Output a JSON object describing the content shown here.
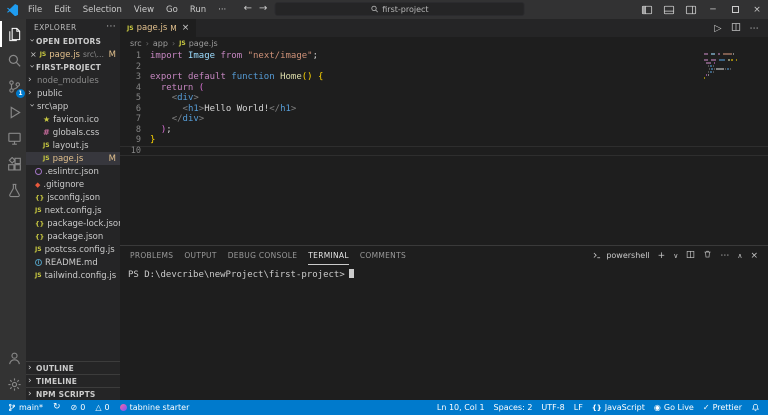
{
  "colors": {
    "accent": "#007acc",
    "git_modified": "#e2c08d",
    "statusbar": "#007acc"
  },
  "titlebar": {
    "menus": [
      "File",
      "Edit",
      "Selection",
      "View",
      "Go",
      "Run",
      "···"
    ],
    "search_value": "first-project",
    "window_icons": [
      "layout-sidebar-icon",
      "layout-panel-icon",
      "layout-sidebar-right-icon",
      "minimize-icon",
      "maximize-icon",
      "close-icon"
    ]
  },
  "activity_bar": {
    "items": [
      {
        "name": "explorer",
        "active": true
      },
      {
        "name": "search"
      },
      {
        "name": "source-control",
        "badge": "1"
      },
      {
        "name": "run-and-debug"
      },
      {
        "name": "remote-explorer"
      },
      {
        "name": "extensions"
      },
      {
        "name": "testing"
      }
    ],
    "bottom_items": [
      {
        "name": "accounts"
      },
      {
        "name": "settings"
      }
    ]
  },
  "sidebar": {
    "title": "EXPLORER",
    "open_editors": {
      "label": "OPEN EDITORS",
      "items": [
        {
          "file": "page.js",
          "path": "src\\app",
          "badge": "M",
          "icon": "js"
        }
      ]
    },
    "project_label": "FIRST-PROJECT",
    "tree": [
      {
        "label": "node_modules",
        "chevron": "right",
        "depth": 1,
        "dim": true
      },
      {
        "label": "public",
        "chevron": "right",
        "depth": 1
      },
      {
        "label": "src\\app",
        "chevron": "down",
        "depth": 1
      },
      {
        "label": "favicon.ico",
        "icon": "star",
        "depth": 2
      },
      {
        "label": "globals.css",
        "icon": "css",
        "depth": 2
      },
      {
        "label": "layout.js",
        "icon": "js",
        "depth": 2
      },
      {
        "label": "page.js",
        "icon": "js",
        "depth": 2,
        "selected": true,
        "modified": true,
        "badge": "M"
      },
      {
        "label": ".eslintrc.json",
        "icon": "eslint",
        "depth": 1
      },
      {
        "label": ".gitignore",
        "icon": "git",
        "depth": 1
      },
      {
        "label": "jsconfig.json",
        "icon": "json",
        "depth": 1
      },
      {
        "label": "next.config.js",
        "icon": "js",
        "depth": 1
      },
      {
        "label": "package-lock.json",
        "icon": "json",
        "depth": 1
      },
      {
        "label": "package.json",
        "icon": "json",
        "depth": 1
      },
      {
        "label": "postcss.config.js",
        "icon": "js",
        "depth": 1
      },
      {
        "label": "README.md",
        "icon": "info",
        "depth": 1
      },
      {
        "label": "tailwind.config.js",
        "icon": "js",
        "depth": 1
      }
    ],
    "bottom_sections": [
      "OUTLINE",
      "TIMELINE",
      "NPM SCRIPTS"
    ]
  },
  "editor": {
    "tab": {
      "label": "page.js",
      "badge": "M"
    },
    "breadcrumb": [
      {
        "label": "src"
      },
      {
        "label": "app"
      },
      {
        "label": "page.js",
        "icon": "js"
      }
    ],
    "code": [
      {
        "n": 1,
        "tokens": [
          [
            "import",
            "kw"
          ],
          [
            " ",
            "fg"
          ],
          [
            "Image",
            "var"
          ],
          [
            " ",
            "fg"
          ],
          [
            "from",
            "kw"
          ],
          [
            " ",
            "fg"
          ],
          [
            "\"next/image\"",
            "str"
          ],
          [
            ";",
            "fg"
          ]
        ]
      },
      {
        "n": 2,
        "tokens": []
      },
      {
        "n": 3,
        "tokens": [
          [
            "export",
            "kw"
          ],
          [
            " ",
            "fg"
          ],
          [
            "default",
            "kw"
          ],
          [
            " ",
            "fg"
          ],
          [
            "function",
            "kw2"
          ],
          [
            " ",
            "fg"
          ],
          [
            "Home",
            "fn"
          ],
          [
            "()",
            "b1"
          ],
          [
            " ",
            "fg"
          ],
          [
            "{",
            "b1"
          ]
        ]
      },
      {
        "n": 4,
        "tokens": [
          [
            "  ",
            "fg"
          ],
          [
            "return",
            "kw"
          ],
          [
            " ",
            "fg"
          ],
          [
            "(",
            "b2"
          ]
        ]
      },
      {
        "n": 5,
        "tokens": [
          [
            "    ",
            "fg"
          ],
          [
            "<",
            "tagb"
          ],
          [
            "div",
            "tag"
          ],
          [
            ">",
            "tagb"
          ]
        ]
      },
      {
        "n": 6,
        "tokens": [
          [
            "      ",
            "fg"
          ],
          [
            "<",
            "tagb"
          ],
          [
            "h1",
            "tag"
          ],
          [
            ">",
            "tagb"
          ],
          [
            "Hello World!",
            "fg"
          ],
          [
            "</",
            "tagb"
          ],
          [
            "h1",
            "tag"
          ],
          [
            ">",
            "tagb"
          ]
        ]
      },
      {
        "n": 7,
        "tokens": [
          [
            "    ",
            "fg"
          ],
          [
            "</",
            "tagb"
          ],
          [
            "div",
            "tag"
          ],
          [
            ">",
            "tagb"
          ]
        ]
      },
      {
        "n": 8,
        "tokens": [
          [
            "  ",
            "fg"
          ],
          [
            ")",
            "b2"
          ],
          [
            ";",
            "fg"
          ]
        ]
      },
      {
        "n": 9,
        "tokens": [
          [
            "}",
            "b1"
          ]
        ]
      },
      {
        "n": 10,
        "tokens": [],
        "current": true
      }
    ]
  },
  "panel": {
    "tabs": [
      {
        "label": "PROBLEMS"
      },
      {
        "label": "OUTPUT"
      },
      {
        "label": "DEBUG CONSOLE"
      },
      {
        "label": "TERMINAL",
        "active": true
      },
      {
        "label": "COMMENTS"
      }
    ],
    "shell": "powershell",
    "prompt": "PS D:\\devcribe\\newProject\\first-project>"
  },
  "status_bar": {
    "left": [
      {
        "name": "git-branch",
        "icon": "branch",
        "text": "main*"
      },
      {
        "name": "sync",
        "icon": "sync",
        "text": ""
      },
      {
        "name": "errors",
        "icon": "error",
        "text": "0"
      },
      {
        "name": "warnings",
        "icon": "warning",
        "text": "0"
      },
      {
        "name": "tabnine",
        "icon": "flame",
        "text": "tabnine starter"
      }
    ],
    "right": [
      {
        "name": "cursor-position",
        "text": "Ln 10, Col 1"
      },
      {
        "name": "indentation",
        "text": "Spaces: 2"
      },
      {
        "name": "encoding",
        "text": "UTF-8"
      },
      {
        "name": "eol",
        "text": "LF"
      },
      {
        "name": "language",
        "icon": "braces",
        "text": "JavaScript"
      },
      {
        "name": "go-live",
        "icon": "broadcast",
        "text": "Go Live"
      },
      {
        "name": "prettier",
        "icon": "check",
        "text": "Prettier"
      },
      {
        "name": "notifications",
        "icon": "bell",
        "text": ""
      }
    ]
  }
}
